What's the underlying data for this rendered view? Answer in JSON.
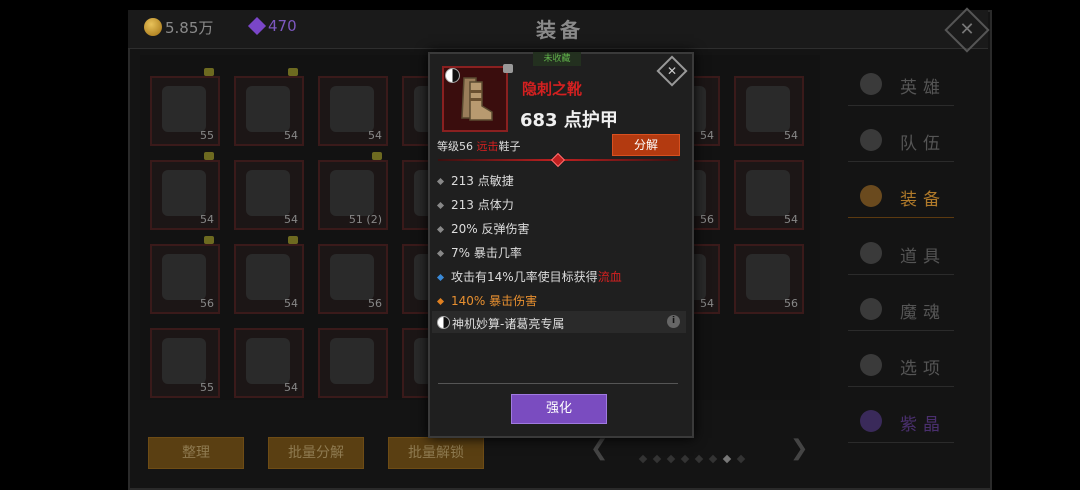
{
  "header": {
    "gold": "5.85万",
    "gems": "470",
    "title": "装备",
    "close_icon": "close-icon"
  },
  "grid": [
    {
      "level": "55",
      "locked": true
    },
    {
      "level": "54",
      "locked": true
    },
    {
      "level": "54",
      "locked": true
    },
    {
      "level": "",
      "locked": false
    },
    {
      "level": "54",
      "locked": true
    },
    {
      "level": "54",
      "locked": true
    },
    {
      "level": "54",
      "locked": true
    },
    {
      "level": "51 (2)",
      "locked": false
    },
    {
      "level": "56",
      "locked": true
    },
    {
      "level": "54",
      "locked": false
    },
    {
      "level": "56",
      "locked": false
    },
    {
      "level": "55",
      "locked": false
    },
    {
      "level": "54",
      "locked": false
    },
    {
      "level": "54",
      "locked": false
    },
    {
      "level": "56",
      "locked": true
    },
    {
      "level": "54",
      "locked": false
    }
  ],
  "grid_right": [
    "54",
    "54",
    "56",
    "54",
    "54",
    "56"
  ],
  "sidebar": [
    {
      "label": "英雄",
      "icon": "hero-icon"
    },
    {
      "label": "队伍",
      "icon": "flag-icon"
    },
    {
      "label": "装备",
      "icon": "helmet-icon"
    },
    {
      "label": "道具",
      "icon": "bag-icon"
    },
    {
      "label": "魔魂",
      "icon": "flame-icon"
    },
    {
      "label": "选项",
      "icon": "gear-icon"
    },
    {
      "label": "紫晶",
      "icon": "crystal-icon"
    }
  ],
  "bottom": {
    "sort": "整理",
    "batch_decompose": "批量分解",
    "batch_unlock": "批量解锁"
  },
  "popup": {
    "unfavorited": "未收藏",
    "name": "隐刺之靴",
    "armor": "683 点护甲",
    "level_prefix": "等级56",
    "level_type": "远击",
    "level_suffix": "鞋子",
    "decompose": "分解",
    "stats": [
      "213 点敏捷",
      "213 点体力",
      "20% 反弹伤害",
      "7% 暴击几率"
    ],
    "special_prefix": "攻击有14%几率使目标获得",
    "special_effect": "流血",
    "crit_damage": "140% 暴击伤害",
    "set_name": "神机妙算-诸葛亮专属",
    "enhance": "强化"
  }
}
